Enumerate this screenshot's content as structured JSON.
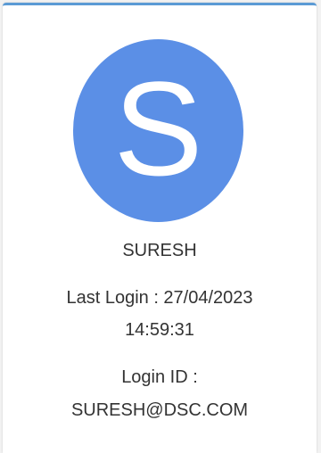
{
  "profile": {
    "avatar_letter": "S",
    "avatar_color": "#5b8fe6",
    "name": "SURESH",
    "last_login_label": "Last Login : 27/04/2023",
    "last_login_time": "14:59:31",
    "login_id_label": "Login ID :",
    "login_id_value": "SURESH@DSC.COM"
  },
  "colors": {
    "card_top_border": "#5b9bd5",
    "text": "#333333"
  }
}
